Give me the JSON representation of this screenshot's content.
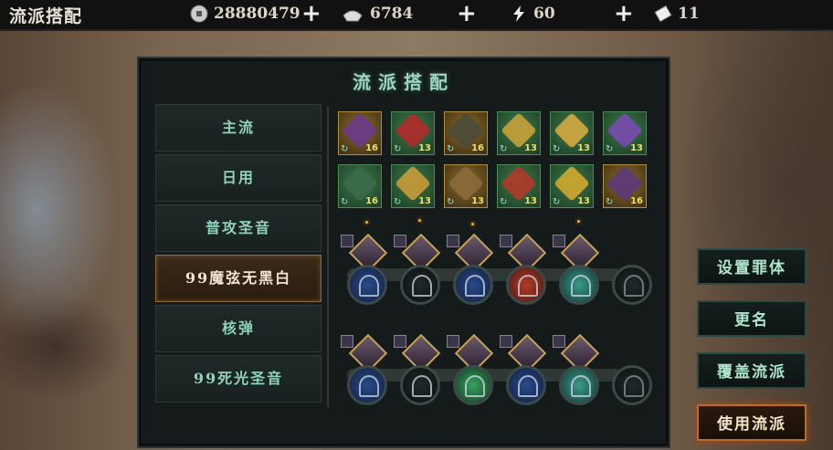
{
  "top_bar": {
    "title": "流派搭配",
    "resources": [
      {
        "icon": "coin-icon",
        "value": "28880479"
      },
      {
        "icon": "ingot-icon",
        "value": "6784"
      },
      {
        "icon": "lightning-icon",
        "value": "60"
      },
      {
        "icon": "ticket-icon",
        "value": "11"
      }
    ],
    "plus_label": "+"
  },
  "panel": {
    "title": "流派搭配",
    "builds": [
      {
        "label": "主流",
        "selected": false
      },
      {
        "label": "日用",
        "selected": false
      },
      {
        "label": "普攻圣音",
        "selected": false
      },
      {
        "label": "99魔弦无黑白",
        "selected": true
      },
      {
        "label": "核弹",
        "selected": false
      },
      {
        "label": "99死光圣音",
        "selected": false
      }
    ],
    "equipment_rows": [
      [
        {
          "icon": "staff-icon",
          "level": "16",
          "rarity": "gold"
        },
        {
          "icon": "claw-icon",
          "level": "13",
          "rarity": "green"
        },
        {
          "icon": "armor-icon",
          "level": "16",
          "rarity": "gold"
        },
        {
          "icon": "robe-icon",
          "level": "13",
          "rarity": "green"
        },
        {
          "icon": "boots-icon",
          "level": "13",
          "rarity": "green"
        },
        {
          "icon": "ring-icon",
          "level": "13",
          "rarity": "green"
        }
      ],
      [
        {
          "icon": "axe-icon",
          "level": "16",
          "rarity": "green"
        },
        {
          "icon": "cloak-icon",
          "level": "13",
          "rarity": "green"
        },
        {
          "icon": "spear-icon",
          "level": "13",
          "rarity": "gold"
        },
        {
          "icon": "belt-icon",
          "level": "13",
          "rarity": "green"
        },
        {
          "icon": "helmet-icon",
          "level": "13",
          "rarity": "green"
        },
        {
          "icon": "blade-icon",
          "level": "16",
          "rarity": "gold"
        }
      ]
    ],
    "rune_rows": [
      [
        "blue",
        "dark-blue",
        "blue",
        "red",
        "teal",
        "empty"
      ],
      [
        "blue",
        "dark-blue",
        "green",
        "blue",
        "teal",
        "empty"
      ]
    ]
  },
  "actions": {
    "set_body": "设置罪体",
    "rename": "更名",
    "overwrite": "覆盖流派",
    "use": "使用流派"
  },
  "colors": {
    "accent_green": "#8fd3b8",
    "selected_gold": "#8a6a40",
    "use_button_glow": "#c06a2a"
  }
}
